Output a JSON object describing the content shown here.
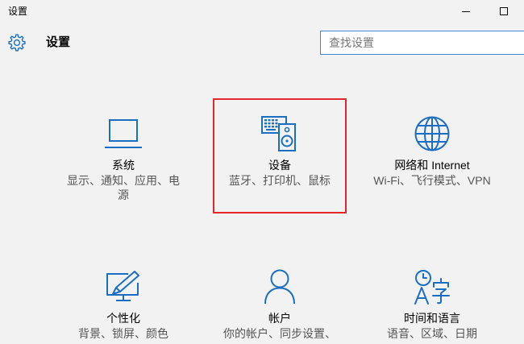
{
  "window": {
    "title": "设置",
    "controls": [
      "minimize-icon",
      "maximize-icon"
    ]
  },
  "header": {
    "icon": "gear-icon",
    "title": "设置",
    "search": {
      "placeholder": "查找设置"
    }
  },
  "categories": [
    {
      "icon": "laptop-icon",
      "label": "系统",
      "description": "显示、通知、应用、电源",
      "highlighted": false
    },
    {
      "icon": "devices-icon",
      "label": "设备",
      "description": "蓝牙、打印机、鼠标",
      "highlighted": true
    },
    {
      "icon": "globe-icon",
      "label": "网络和 Internet",
      "description": "Wi-Fi、飞行模式、VPN",
      "highlighted": false
    },
    {
      "icon": "personalization-icon",
      "label": "个性化",
      "description": "背景、锁屏、颜色",
      "highlighted": false
    },
    {
      "icon": "person-icon",
      "label": "帐户",
      "description": "你的帐户、同步设置、",
      "highlighted": false
    },
    {
      "icon": "time-language-icon",
      "label": "时间和语言",
      "description": "语音、区域、日期",
      "highlighted": false
    }
  ],
  "colors": {
    "accent": "#1b6ec2",
    "background": "#f2f2f2",
    "search_border": "#3c8ad8",
    "highlight_box": "#e0282e",
    "text": "#000000",
    "secondary_text": "#555555"
  }
}
